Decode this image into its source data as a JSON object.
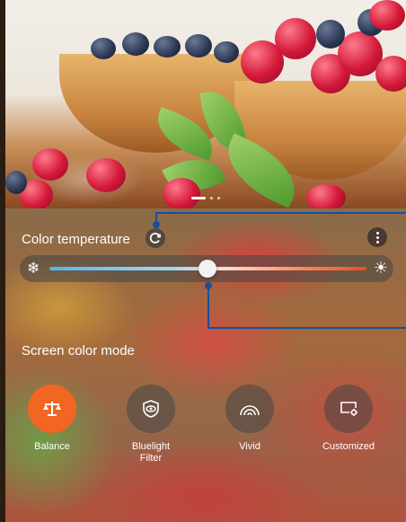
{
  "colors": {
    "accent_active": "#f26522",
    "callout_line": "#1b4e9a",
    "slider_cold": "#4fb6ee",
    "slider_warm": "#ef4a24"
  },
  "wallpaper": {
    "description_icon": "berries-wallpaper",
    "page_indicator": {
      "count": 3,
      "active_index": 0
    }
  },
  "color_temperature": {
    "label": "Color temperature",
    "reset_icon": "refresh-icon",
    "menu_icon": "more-vertical-icon",
    "cold_icon": "snowflake-icon",
    "warm_icon": "sun-icon",
    "slider_value": 0.5
  },
  "screen_color_mode": {
    "label": "Screen color mode",
    "modes": [
      {
        "label": "Balance",
        "icon": "balance-scale-icon",
        "active": true
      },
      {
        "label": "Bluelight\nFilter",
        "icon": "eye-shield-icon",
        "active": false
      },
      {
        "label": "Vivid",
        "icon": "rainbow-icon",
        "active": false
      },
      {
        "label": "Customized",
        "icon": "screen-settings-icon",
        "active": false
      }
    ]
  }
}
